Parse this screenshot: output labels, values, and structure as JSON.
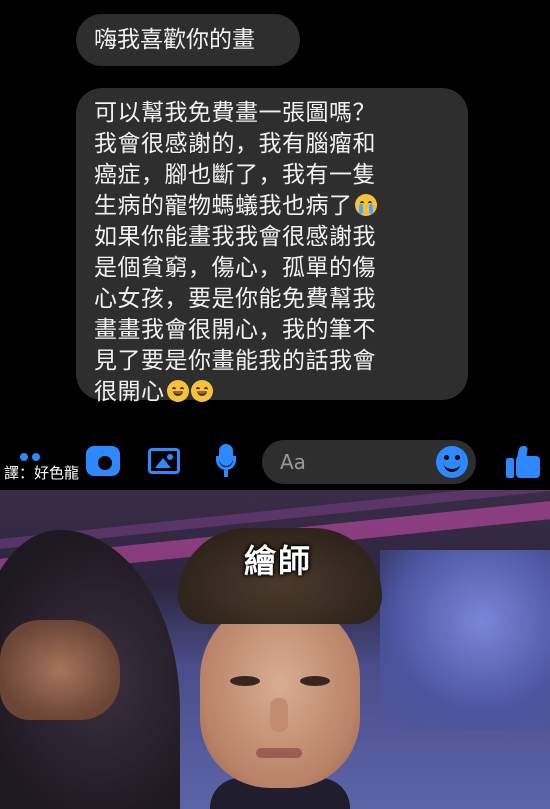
{
  "messages": [
    {
      "text": "嗨我喜歡你的畫"
    },
    {
      "text": "可以幫我免費畫一張圖嗎？\n我會很感謝的，我有腦瘤和\n癌症，腳也斷了，我有一隻\n生病的寵物螞蟻我也病了",
      "text_b": "\n如果你能畫我我會很感謝我\n是個貧窮，傷心，孤單的傷\n心女孩，要是你能免費幫我\n畫畫我會很開心，我的筆不\n見了要是你畫能我的話我會\n很開心"
    }
  ],
  "composer": {
    "placeholder": "Aa"
  },
  "translator_credit": "譯：好色龍",
  "meme_caption": "繪師",
  "icons": {
    "accent_color": "#2e89ff",
    "list": [
      "more-dots-icon",
      "camera-icon",
      "image-icon",
      "microphone-icon",
      "emoji-icon",
      "like-thumb-icon"
    ]
  }
}
